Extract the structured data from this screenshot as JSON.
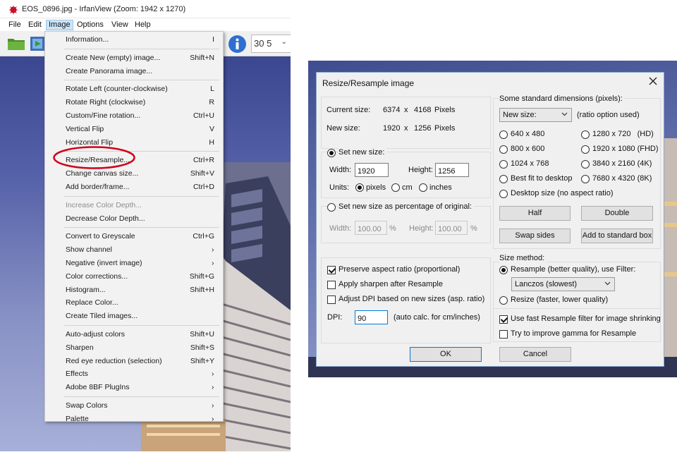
{
  "irfanview": {
    "window_title": "EOS_0896.jpg - IrfanView (Zoom: 1942 x 1270)",
    "menubar": [
      "File",
      "Edit",
      "Image",
      "Options",
      "View",
      "Help"
    ],
    "zoom_value": "30 5",
    "image_menu": [
      {
        "label": "Information...",
        "shortcut": "I"
      },
      {
        "sep": true
      },
      {
        "label": "Create New (empty) image...",
        "shortcut": "Shift+N"
      },
      {
        "label": "Create Panorama image..."
      },
      {
        "sep": true
      },
      {
        "label": "Rotate Left (counter-clockwise)",
        "shortcut": "L"
      },
      {
        "label": "Rotate Right (clockwise)",
        "shortcut": "R"
      },
      {
        "label": "Custom/Fine rotation...",
        "shortcut": "Ctrl+U"
      },
      {
        "label": "Vertical Flip",
        "shortcut": "V"
      },
      {
        "label": "Horizontal Flip",
        "shortcut": "H"
      },
      {
        "sep": true
      },
      {
        "label": "Resize/Resample...",
        "shortcut": "Ctrl+R",
        "highlighted": true
      },
      {
        "label": "Change canvas size...",
        "shortcut": "Shift+V"
      },
      {
        "label": "Add border/frame...",
        "shortcut": "Ctrl+D"
      },
      {
        "sep": true
      },
      {
        "label": "Increase Color Depth...",
        "disabled": true
      },
      {
        "label": "Decrease Color Depth..."
      },
      {
        "sep": true
      },
      {
        "label": "Convert to Greyscale",
        "shortcut": "Ctrl+G"
      },
      {
        "label": "Show channel",
        "submenu": true
      },
      {
        "label": "Negative (invert image)",
        "submenu": true
      },
      {
        "label": "Color corrections...",
        "shortcut": "Shift+G"
      },
      {
        "label": "Histogram...",
        "shortcut": "Shift+H"
      },
      {
        "label": "Replace Color..."
      },
      {
        "label": "Create Tiled images..."
      },
      {
        "sep": true
      },
      {
        "label": "Auto-adjust colors",
        "shortcut": "Shift+U"
      },
      {
        "label": "Sharpen",
        "shortcut": "Shift+S"
      },
      {
        "label": "Red eye reduction (selection)",
        "shortcut": "Shift+Y"
      },
      {
        "label": "Effects",
        "submenu": true
      },
      {
        "label": "Adobe 8BF PlugIns",
        "submenu": true
      },
      {
        "sep": true
      },
      {
        "label": "Swap Colors",
        "submenu": true
      },
      {
        "label": "Palette",
        "submenu": true
      }
    ],
    "submenu_arrow": "›"
  },
  "resize_dialog": {
    "title": "Resize/Resample image",
    "current_size_label": "Current size:",
    "current_w": "6374",
    "current_h": "4168",
    "new_size_label": "New size:",
    "new_w": "1920",
    "new_h": "1256",
    "x": "x",
    "pixels_unit": "Pixels",
    "set_new_size": "Set new size:",
    "width_label": "Width:",
    "height_label": "Height:",
    "width_value": "1920",
    "height_value": "1256",
    "units_label": "Units:",
    "unit_pixels": "pixels",
    "unit_cm": "cm",
    "unit_inches": "inches",
    "set_percentage": "Set new size as percentage of original:",
    "pct_width_value": "100.00",
    "pct_height_value": "100.00",
    "pct_sign": "%",
    "preserve_aspect": "Preserve aspect ratio (proportional)",
    "apply_sharpen": "Apply sharpen after Resample",
    "adjust_dpi": "Adjust DPI based on new sizes (asp. ratio)",
    "dpi_label": "DPI:",
    "dpi_value": "90",
    "dpi_note": "(auto calc. for cm/inches)",
    "standard_dims_label": "Some standard dimensions (pixels):",
    "new_size_select": "New size:",
    "ratio_note": "(ratio option used)",
    "dims": [
      "640 x 480",
      "1280 x 720   (HD)",
      "800 x 600",
      "1920 x 1080 (FHD)",
      "1024 x 768",
      "3840 x 2160 (4K)",
      "Best fit to desktop",
      "7680 x 4320 (8K)"
    ],
    "desktop_size": "Desktop size (no aspect ratio)",
    "half_btn": "Half",
    "double_btn": "Double",
    "swap_btn": "Swap sides",
    "add_std_btn": "Add to standard box",
    "size_method_label": "Size method:",
    "resample_label": "Resample (better quality), use Filter:",
    "filter_value": "Lanczos (slowest)",
    "resize_label": "Resize (faster, lower quality)",
    "fast_resample": "Use fast Resample filter for image shrinking",
    "improve_gamma": "Try to improve gamma for Resample",
    "ok_btn": "OK",
    "cancel_btn": "Cancel"
  },
  "colors": {
    "highlight_ring": "#d0021b",
    "selection_blue": "#0078d7",
    "photo_sky": "#5561a8"
  }
}
